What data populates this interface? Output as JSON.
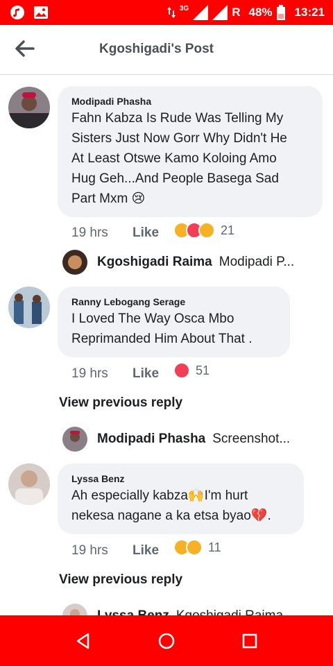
{
  "status_bar": {
    "network": "3G",
    "roaming": "R",
    "battery": "48%",
    "time": "13:21",
    "icons": [
      "music-icon",
      "image-icon",
      "signal-icon",
      "battery-icon"
    ]
  },
  "header": {
    "title": "Kgoshigadi's Post",
    "back_icon": "arrow-left-icon"
  },
  "comments": [
    {
      "name": "Modipadi Phasha",
      "lines": [
        "Fahn Kabza Is Rude Was Telling My",
        "Sisters Just Now Gorr Why Didn't He",
        "At Least Otswe Kamo Koloing Amo",
        "Hug Geh...And People Basega Sad",
        "Part Mxm 😢"
      ],
      "time": "19 hrs",
      "like": "Like",
      "reaction_count": "21",
      "reactions": [
        "sad",
        "love",
        "haha"
      ],
      "reply": {
        "name": "Kgoshigadi Raima",
        "text": "Modipadi P..."
      }
    },
    {
      "name": "Ranny Lebogang Serage",
      "lines": [
        "I Loved The Way Osca Mbo",
        "Reprimanded Him About That ."
      ],
      "time": "19 hrs",
      "like": "Like",
      "reaction_count": "51",
      "reactions": [
        "love"
      ],
      "view_previous": "View previous reply",
      "reply": {
        "name": "Modipadi Phasha",
        "text": "Screenshot..."
      }
    },
    {
      "name": "Lyssa Benz",
      "lines": [
        "Ah especially kabza🙌I'm hurt",
        "nekesa nagane a ka etsa byao💔."
      ],
      "time": "19 hrs",
      "like": "Like",
      "reaction_count": "11",
      "reactions": [
        "sad",
        "wow"
      ],
      "view_previous": "View previous reply",
      "reply": {
        "name": "Lyssa Benz",
        "text": "Kgoshigadi Raima"
      }
    }
  ],
  "colors": {
    "status_bar": "#ff0000",
    "bubble": "#f0f2f5",
    "love": "#f33e58",
    "sad": "#f7b125"
  },
  "nav": {
    "back_icon": "triangle-back-icon",
    "home_icon": "circle-home-icon",
    "recents_icon": "square-recents-icon"
  }
}
